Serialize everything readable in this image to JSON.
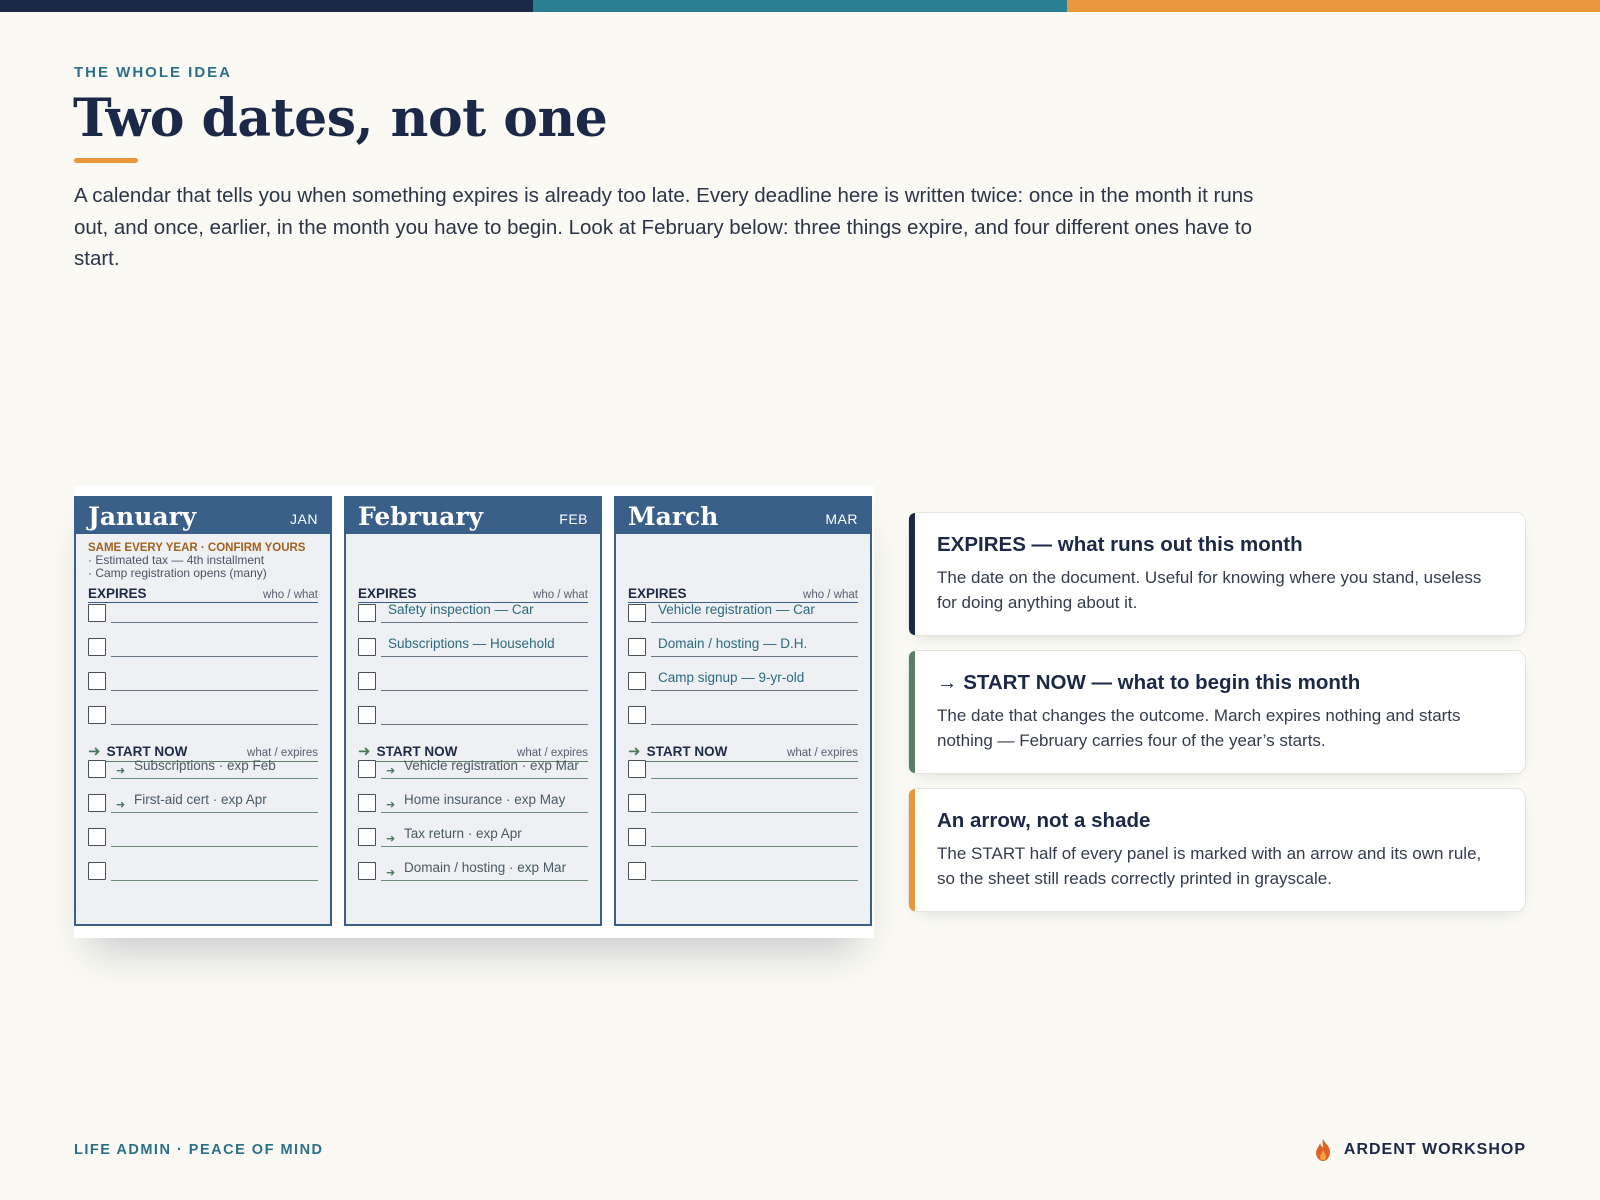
{
  "colors": {
    "navy": "#1c2848",
    "teal": "#2b7f93",
    "orange": "#e9973a",
    "panel_blue": "#3a5f88",
    "green": "#5c7e66",
    "background": "#faf9f3"
  },
  "header": {
    "kicker": "THE WHOLE IDEA",
    "title": "Two dates, not one",
    "intro": "A calendar that tells you when something expires is already too late. Every deadline here is written twice: once in the month it runs out, and once, earlier, in the month you have to begin. Look at February below: three things expire, and four different ones have to start."
  },
  "sheet": {
    "expires_label": "EXPIRES",
    "expires_hint": "who / what",
    "start_label": "START NOW",
    "start_hint": "what / expires",
    "panels": [
      {
        "month": "January",
        "abbr": "JAN",
        "note_head": "SAME EVERY YEAR · CONFIRM YOURS",
        "note_items": [
          "· Estimated tax — 4th installment",
          "· Camp registration opens (many)"
        ],
        "expires": [
          "",
          "",
          "",
          ""
        ],
        "start": [
          "Subscriptions · exp Feb",
          "First-aid cert · exp Apr",
          "",
          ""
        ]
      },
      {
        "month": "February",
        "abbr": "FEB",
        "note_head": "",
        "note_items": [],
        "expires": [
          "Safety inspection — Car",
          "Subscriptions — Household",
          "",
          ""
        ],
        "start": [
          "Vehicle registration · exp Mar",
          "Home insurance · exp May",
          "Tax return · exp Apr",
          "Domain / hosting · exp Mar"
        ]
      },
      {
        "month": "March",
        "abbr": "MAR",
        "note_head": "",
        "note_items": [],
        "expires": [
          "Vehicle registration — Car",
          "Domain / hosting — D.H.",
          "Camp signup — 9-yr-old",
          ""
        ],
        "start": [
          "",
          "",
          "",
          ""
        ]
      }
    ]
  },
  "cards": [
    {
      "title": "EXPIRES — what runs out this month",
      "body": "The date on the document. Useful for knowing where you stand, useless for doing anything about it.",
      "accent": "#1c2848"
    },
    {
      "title": "→ START NOW — what to begin this month",
      "body": "The date that changes the outcome. March expires nothing and starts nothing — February carries four of the year’s starts.",
      "accent": "#5c7e66"
    },
    {
      "title": "An arrow, not a shade",
      "body": "The START half of every panel is marked with an arrow and its own rule, so the sheet still reads correctly printed in grayscale.",
      "accent": "#e9973a"
    }
  ],
  "footer": {
    "left": "LIFE ADMIN · PEACE OF MIND",
    "brand": "ARDENT WORKSHOP",
    "brand_icon": "flame-icon"
  }
}
